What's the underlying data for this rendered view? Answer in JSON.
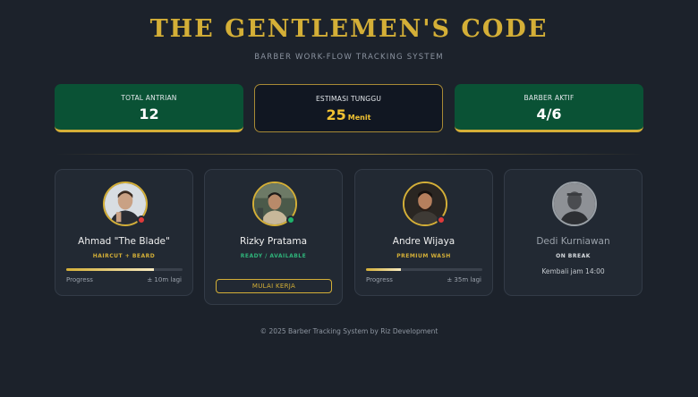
{
  "header": {
    "title": "THE GENTLEMEN'S CODE",
    "subtitle": "BARBER WORK-FLOW TRACKING SYSTEM"
  },
  "stats": {
    "total_queue": {
      "label": "TOTAL ANTRIAN",
      "value": "12"
    },
    "wait_estimate": {
      "label": "ESTIMASI TUNGGU",
      "value": "25",
      "unit": "Menit"
    },
    "active_barbers": {
      "label": "BARBER AKTIF",
      "value": "4/6"
    }
  },
  "barbers": [
    {
      "name": "Ahmad \"The Blade\"",
      "tag": "HAIRCUT + BEARD",
      "status": "busy",
      "progress": 0.75,
      "progress_label": "Progress",
      "eta": "± 10m lagi",
      "icon": "barber-avatar-photo"
    },
    {
      "name": "Rizky Pratama",
      "tag": "READY / AVAILABLE",
      "status": "available",
      "action_label": "MULAI KERJA",
      "icon": "barber-avatar-photo"
    },
    {
      "name": "Andre Wijaya",
      "tag": "PREMIUM WASH",
      "status": "busy",
      "progress": 0.3,
      "progress_label": "Progress",
      "eta": "± 35m lagi",
      "icon": "barber-avatar-photo"
    },
    {
      "name": "Dedi Kurniawan",
      "tag": "ON BREAK",
      "status": "break",
      "note": "Kembali jam 14:00",
      "icon": "barber-avatar-photo-greyscale"
    }
  ],
  "footer": {
    "text": "© 2025 Barber Tracking System by Riz Development"
  },
  "colors": {
    "background": "#1c222b",
    "gold": "#d4af37",
    "green_card": "#0a5235",
    "status_busy": "#e03a3a",
    "status_available": "#1fb36b"
  }
}
